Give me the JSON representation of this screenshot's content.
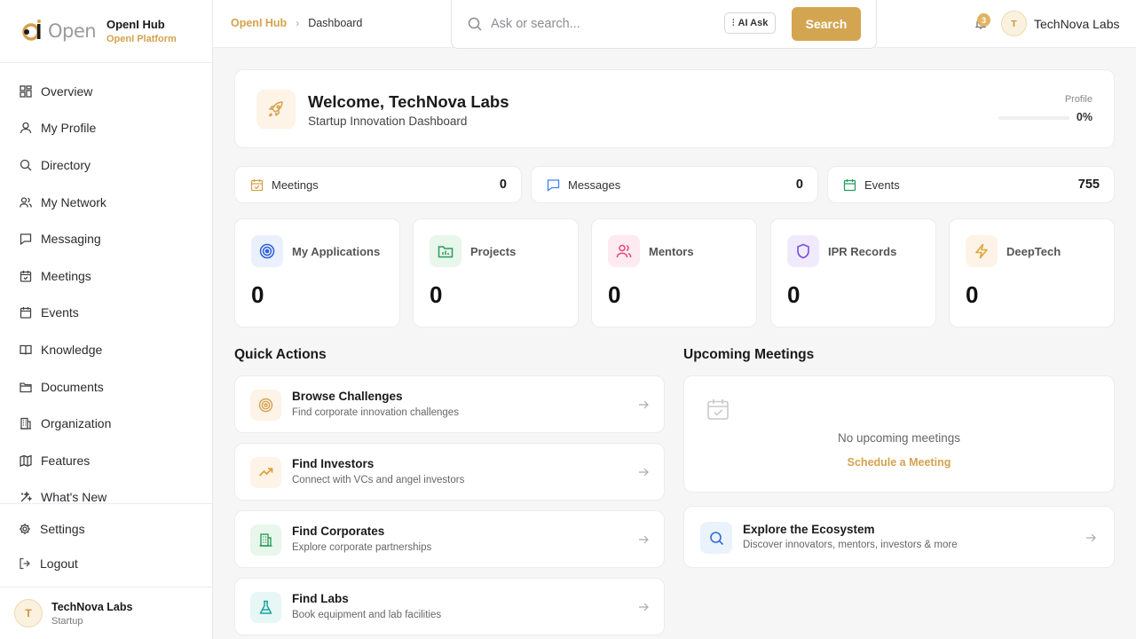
{
  "brand": {
    "logo_text": "Open",
    "title": "OpenI Hub",
    "subtitle": "OpenI Platform"
  },
  "sidebar": {
    "items": [
      {
        "label": "Overview",
        "icon": "grid-icon"
      },
      {
        "label": "My Profile",
        "icon": "user-icon"
      },
      {
        "label": "Directory",
        "icon": "search-icon"
      },
      {
        "label": "My Network",
        "icon": "users-icon"
      },
      {
        "label": "Messaging",
        "icon": "chat-icon"
      },
      {
        "label": "Meetings",
        "icon": "calendar-check-icon"
      },
      {
        "label": "Events",
        "icon": "calendar-icon"
      },
      {
        "label": "Knowledge",
        "icon": "book-icon"
      },
      {
        "label": "Documents",
        "icon": "folder-icon"
      },
      {
        "label": "Organization",
        "icon": "building-icon"
      },
      {
        "label": "Features",
        "icon": "map-icon"
      },
      {
        "label": "What's New",
        "icon": "sparkle-icon"
      }
    ],
    "settings_label": "Settings",
    "logout_label": "Logout",
    "user": {
      "initial": "T",
      "name": "TechNova Labs",
      "role": "Startup"
    }
  },
  "header": {
    "breadcrumb": {
      "root": "OpenI Hub",
      "sep": "›",
      "current": "Dashboard"
    },
    "search_placeholder": "Ask or search...",
    "ai_ask_label": "AI Ask",
    "search_button": "Search",
    "notification_count": "3",
    "user": {
      "initial": "T",
      "name": "TechNova Labs"
    }
  },
  "welcome": {
    "title": "Welcome, TechNova Labs",
    "subtitle": "Startup Innovation Dashboard",
    "profile_label": "Profile",
    "profile_percent": "0%",
    "profile_progress": 0
  },
  "stats": [
    {
      "label": "Meetings",
      "value": "0"
    },
    {
      "label": "Messages",
      "value": "0"
    },
    {
      "label": "Events",
      "value": "755"
    }
  ],
  "metrics": [
    {
      "label": "My Applications",
      "value": "0"
    },
    {
      "label": "Projects",
      "value": "0"
    },
    {
      "label": "Mentors",
      "value": "0"
    },
    {
      "label": "IPR Records",
      "value": "0"
    },
    {
      "label": "DeepTech",
      "value": "0"
    }
  ],
  "quick_actions": {
    "title": "Quick Actions",
    "items": [
      {
        "title": "Browse Challenges",
        "subtitle": "Find corporate innovation challenges"
      },
      {
        "title": "Find Investors",
        "subtitle": "Connect with VCs and angel investors"
      },
      {
        "title": "Find Corporates",
        "subtitle": "Explore corporate partnerships"
      },
      {
        "title": "Find Labs",
        "subtitle": "Book equipment and lab facilities"
      }
    ]
  },
  "upcoming": {
    "title": "Upcoming Meetings",
    "empty_text": "No upcoming meetings",
    "schedule_link": "Schedule a Meeting"
  },
  "explore": {
    "title": "Explore the Ecosystem",
    "subtitle": "Discover innovators, mentors, investors & more"
  },
  "colors": {
    "accent": "#d4a551",
    "accent_text": "#d4a24c"
  }
}
